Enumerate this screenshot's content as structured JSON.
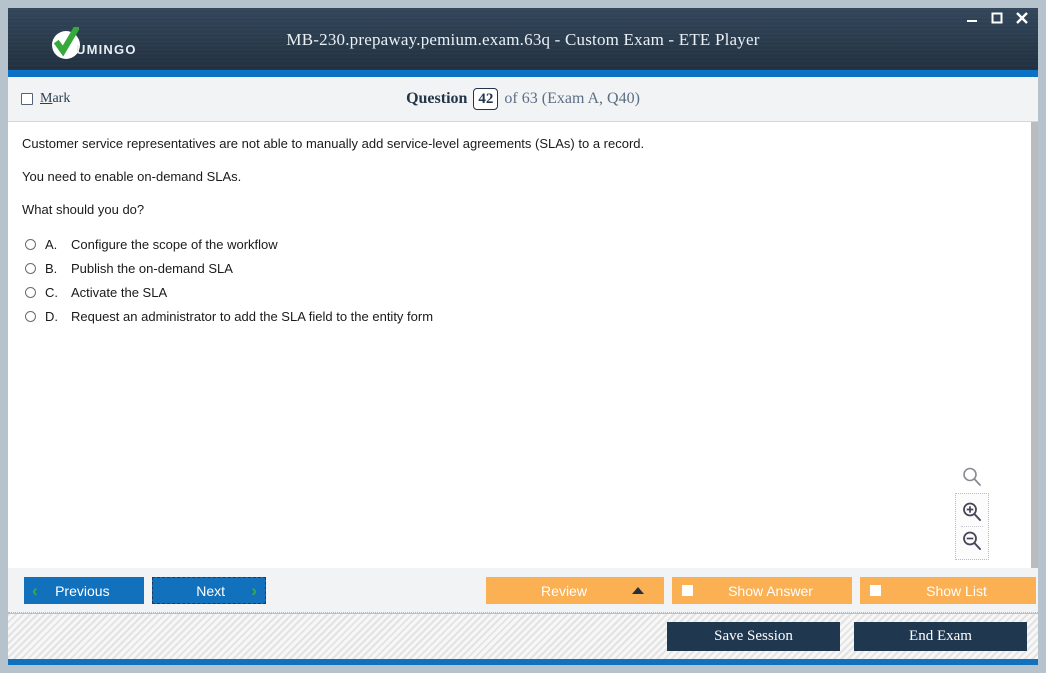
{
  "window": {
    "title": "MB-230.prepaway.pemium.exam.63q - Custom Exam - ETE Player",
    "logo_text": "UMINGO",
    "controls": {
      "minimize": "minimize-icon",
      "maximize": "maximize-icon",
      "close": "close-icon"
    }
  },
  "question_header": {
    "mark_label_accel": "M",
    "mark_label_rest": "ark",
    "question_word": "Question",
    "question_number": "42",
    "question_of": "of 63 (Exam A, Q40)"
  },
  "question": {
    "paragraphs": [
      "Customer service representatives are not able to manually add service-level agreements (SLAs) to a record.",
      "You need to enable on-demand SLAs.",
      "What should you do?"
    ],
    "options": [
      {
        "letter": "A.",
        "text": "Configure the scope of the workflow"
      },
      {
        "letter": "B.",
        "text": "Publish the on-demand SLA"
      },
      {
        "letter": "C.",
        "text": "Activate the SLA"
      },
      {
        "letter": "D.",
        "text": "Request an administrator to add the SLA field to the entity form"
      }
    ]
  },
  "zoom_controls": {
    "reset": "magnifier-icon",
    "zoom_in": "zoom-in-icon",
    "zoom_out": "zoom-out-icon"
  },
  "toolbar": {
    "previous": "Previous",
    "next": "Next",
    "review": "Review",
    "show_answer": "Show Answer",
    "show_list": "Show List"
  },
  "footer": {
    "save_session": "Save Session",
    "end_exam": "End Exam"
  },
  "colors": {
    "header_dark": "#2c3e50",
    "accent_blue": "#0b72c4",
    "nav_blue": "#1271bd",
    "orange": "#fbb054",
    "dark_button": "#1f3850",
    "logo_green": "#36a93b"
  }
}
